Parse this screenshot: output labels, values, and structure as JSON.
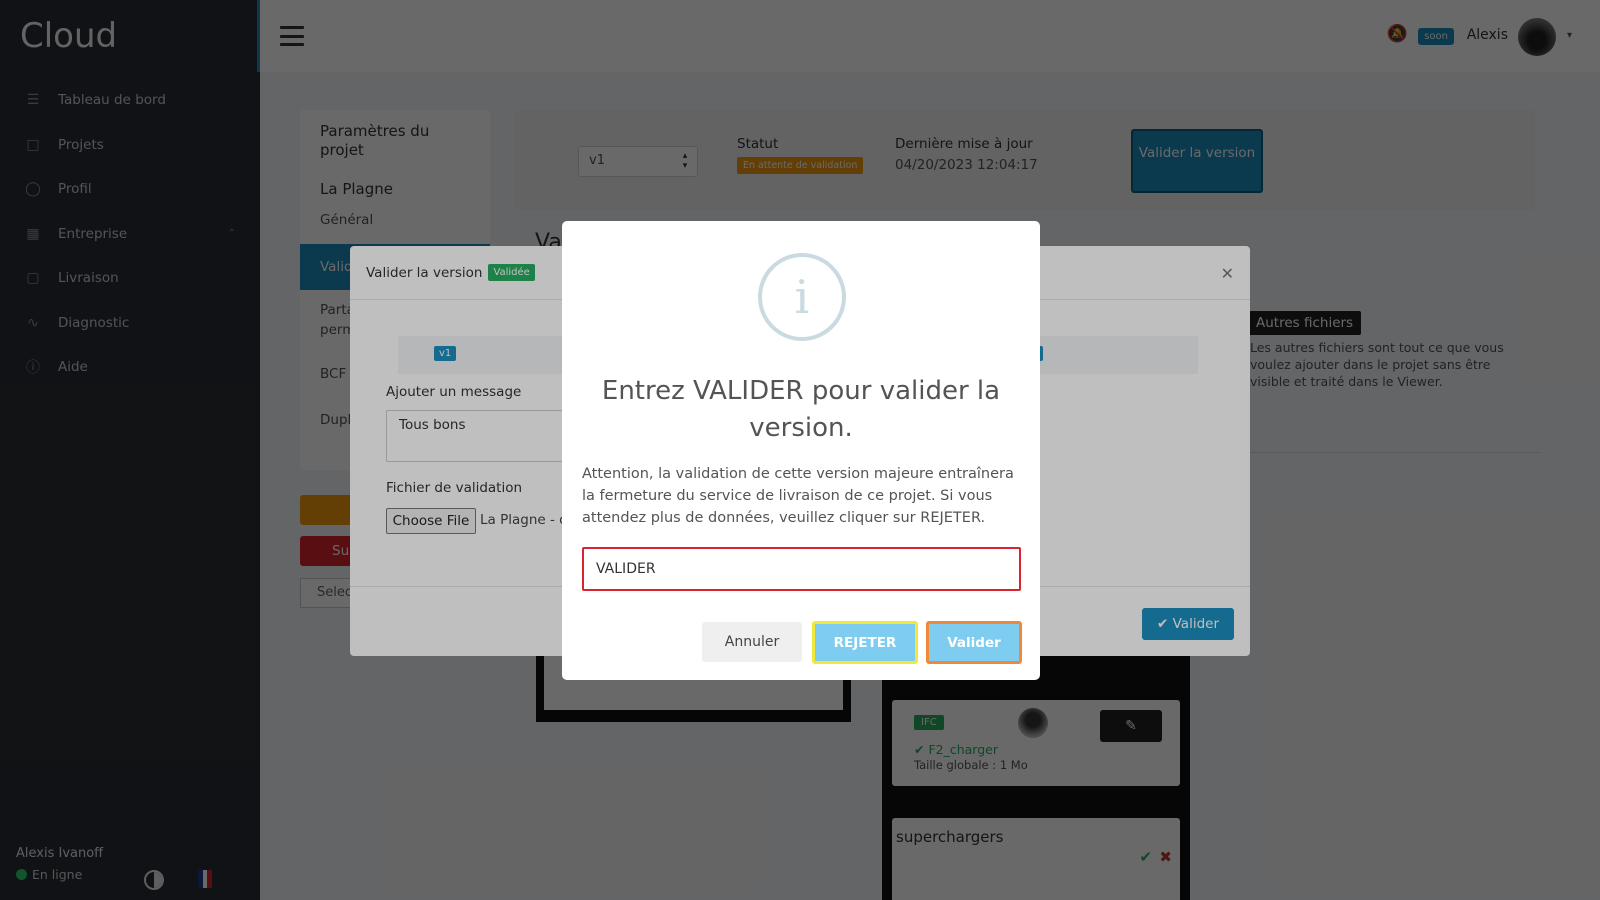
{
  "app": {
    "brand": "Cloud"
  },
  "sidebar": {
    "items": [
      {
        "label": "Tableau de bord",
        "icon": "sliders-icon"
      },
      {
        "label": "Projets",
        "icon": "folder-icon"
      },
      {
        "label": "Profil",
        "icon": "user-icon"
      },
      {
        "label": "Entreprise",
        "icon": "building-icon"
      },
      {
        "label": "Livraison",
        "icon": "truck-icon"
      },
      {
        "label": "Diagnostic",
        "icon": "pulse-icon"
      },
      {
        "label": "Aide",
        "icon": "help-icon"
      }
    ],
    "user_name": "Alexis Ivanoff",
    "user_status": "En ligne"
  },
  "topbar": {
    "soon_badge": "soon",
    "user_name": "Alexis"
  },
  "page": {
    "left_title": "Paramètres du projet",
    "project_name": "La Plagne",
    "nav": [
      "Général",
      "Valid",
      "Parta",
      "perm",
      "BCF",
      "Dupl"
    ],
    "btn_su": "Su",
    "select_partial": "Selec",
    "version_select": "v1",
    "statut_label": "Statut",
    "statut_badge": "En attente de validation",
    "maj_label": "Dernière mise à jour",
    "maj_date": "04/20/2023 12:04:17",
    "valider_version_btn": "Valider la version",
    "partial_title": "Va",
    "autres_badge": "Autres fichiers",
    "autres_desc": "Les autres fichiers sont tout ce que vous voulez ajouter dans le projet sans être visible et traité dans le Viewer.",
    "file_card": {
      "badge": "IFC",
      "name": "F2_charger",
      "size": "Taille globale : 1 Mo"
    },
    "group_title": "superchargers"
  },
  "mid_modal": {
    "title": "Valider la version",
    "badge": "Validée",
    "v1_badge": "v1",
    "message_label": "Ajouter un message",
    "message_value": "Tous bons",
    "file_label": "Fichier de validation",
    "choose_file": "Choose File",
    "file_name": "La Plagne - c",
    "valider_btn": "Valider"
  },
  "dialog": {
    "icon": "i",
    "title": "Entrez VALIDER pour valider la version.",
    "text": "Attention, la validation de cette version majeure entraînera la fermeture du service de livraison de ce projet. Si vous attendez plus de données, veuillez cliquer sur REJETER.",
    "input_value": "VALIDER",
    "annuler": "Annuler",
    "rejeter": "REJETER",
    "valider": "Valider"
  }
}
